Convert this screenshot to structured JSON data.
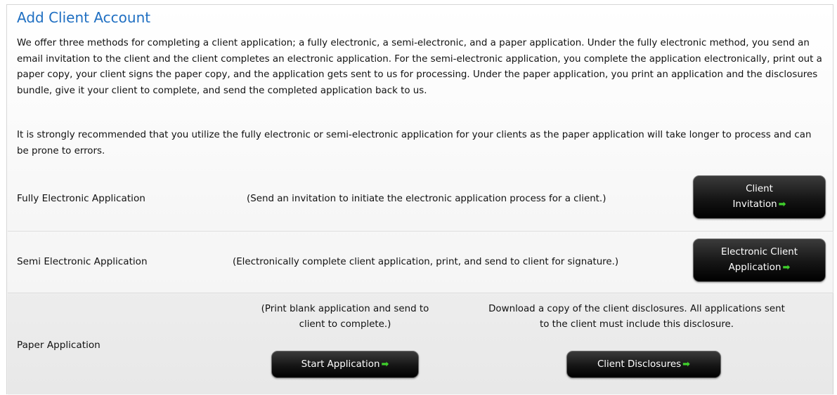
{
  "header": {
    "title": "Add Client Account"
  },
  "intro": {
    "paragraph1": "We offer three methods for completing a client application; a fully electronic, a semi-electronic, and a paper application. Under the fully electronic method, you send an email invitation to the client and the client completes an electronic application. For the semi-electronic application, you complete the application electronically, print out a paper copy, your client signs the paper copy, and the application gets sent to us for processing. Under the paper application, you print an application and the disclosures bundle, give it your client to complete, and send the completed application back to us.",
    "paragraph2": "It is strongly recommended that you utilize the fully electronic or semi-electronic application for your clients as the paper application will take longer to process and can be prone to errors."
  },
  "options": {
    "fully": {
      "label": "Fully Electronic Application",
      "description": "(Send an invitation to initiate the electronic application process for a client.)",
      "button_line1": "Client",
      "button_line2": "Invitation"
    },
    "semi": {
      "label": "Semi Electronic Application",
      "description": "(Electronically complete client application, print, and send to client for signature.)",
      "button_line1": "Electronic Client",
      "button_line2": "Application"
    },
    "paper": {
      "label": "Paper Application",
      "start_description_line1": "(Print blank application and send to",
      "start_description_line2": "client to complete.)",
      "start_button": "Start Application",
      "disclosure_description_line1": "Download a copy of the client disclosures. All applications sent",
      "disclosure_description_line2": "to the client must include this disclosure.",
      "disclosure_button": "Client Disclosures"
    }
  },
  "icons": {
    "arrow": "➡"
  },
  "colors": {
    "title": "#1f6fc2",
    "arrow": "#3fcf2c",
    "button": "#151515"
  }
}
